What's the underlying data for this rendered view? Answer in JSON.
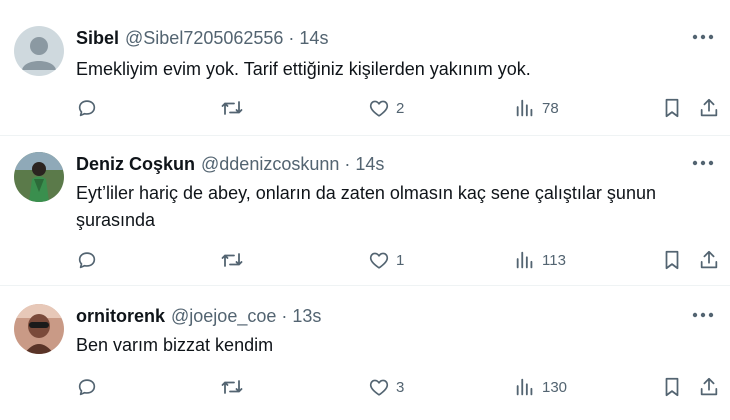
{
  "tweets": [
    {
      "name": "Sibel",
      "handle": "@Sibel7205062556",
      "dot": "·",
      "time": "14s",
      "text": "Emekliyim evim yok. Tarif ettiğiniz kişilerden yakınım yok.",
      "likes": "2",
      "views": "78",
      "avatar": "default-avatar"
    },
    {
      "name": "Deniz Coşkun",
      "handle": "@ddenizcoskunn",
      "dot": "·",
      "time": "14s",
      "text": "Eyt’liler hariç de abey, onların da zaten olmasın kaç sene çalıştılar şunun şurasında",
      "likes": "1",
      "views": "113",
      "avatar": "person-photo"
    },
    {
      "name": "ornitorenk",
      "handle": "@joejoe_coe",
      "dot": "·",
      "time": "13s",
      "text": "Ben varım bizzat kendim",
      "likes": "3",
      "views": "130",
      "avatar": "person-photo"
    }
  ],
  "icons": [
    "reply-icon",
    "retweet-icon",
    "like-icon",
    "views-icon",
    "bookmark-icon",
    "share-icon",
    "more-icon"
  ],
  "colors": {
    "text": "#0f1419",
    "secondary": "#536471",
    "divider": "#eff3f4"
  }
}
